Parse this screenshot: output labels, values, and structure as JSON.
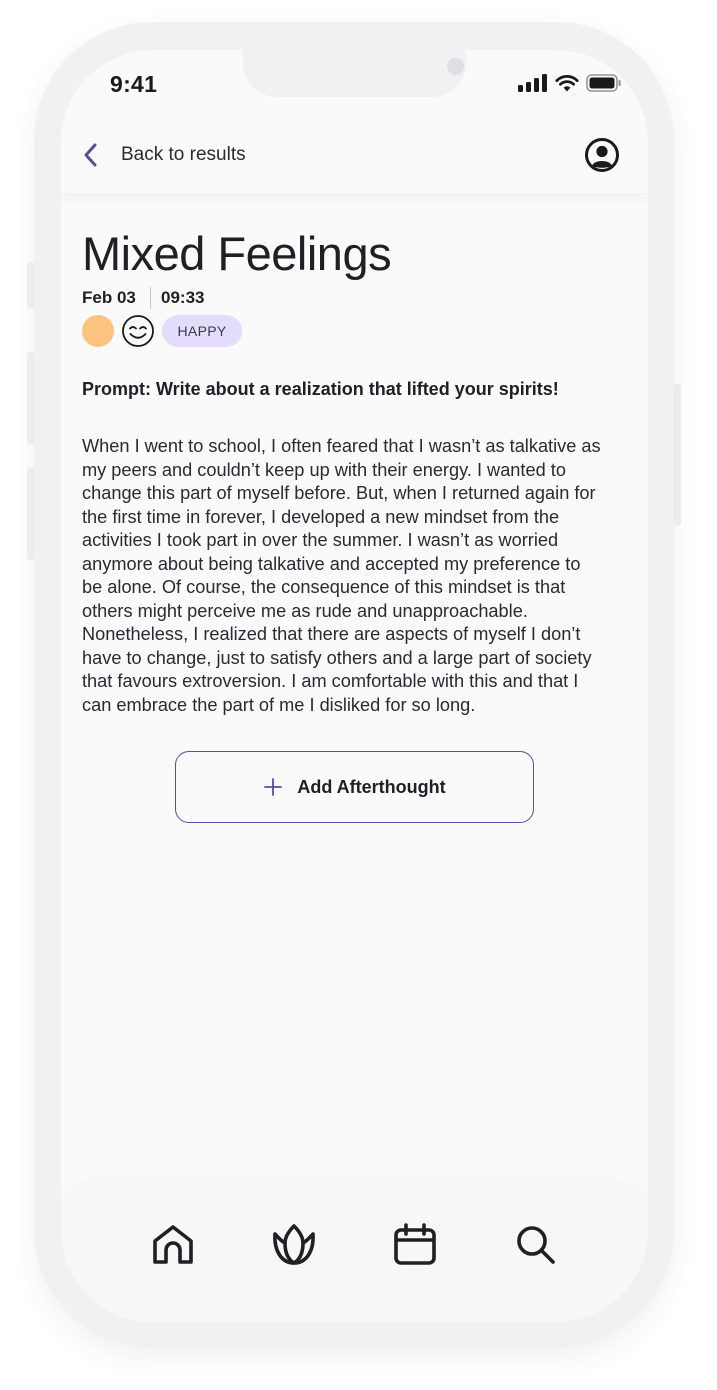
{
  "status_bar": {
    "time": "9:41"
  },
  "header": {
    "back_label": "Back to results"
  },
  "entry": {
    "title": "Mixed Feelings",
    "date": "Feb 03",
    "time": "09:33",
    "mood": {
      "label": "HAPPY",
      "color": "#fdc381",
      "badge_color": "#e4dcfb"
    },
    "prompt": "Prompt: Write about a realization that lifted your spirits!",
    "body_lines": [
      "When I went to school, I often feared that I wasn’t as talkative as",
      "my peers and couldn’t keep up with their energy. I wanted to",
      "change this part of myself before. But, when I returned again for",
      "the first time in forever, I developed a new mindset from the",
      "activities I took part in over the summer. I wasn’t as worried",
      "anymore about being talkative and accepted my preference to",
      "be alone. Of course, the consequence of this mindset is that",
      "others might perceive me as rude and unapproachable.",
      "Nonetheless, I realized that there are aspects of myself I don’t",
      "have to change, just to satisfy others and a large part of society",
      "that favours extroversion. I am comfortable with this and that I",
      "can embrace the part of me I disliked for so long."
    ]
  },
  "actions": {
    "add_afterthought": "Add Afterthought"
  },
  "tabs": [
    {
      "icon": "home-icon"
    },
    {
      "icon": "lotus-icon"
    },
    {
      "icon": "calendar-icon"
    },
    {
      "icon": "search-icon"
    }
  ],
  "colors": {
    "accent": "#5a4d9f",
    "background": "#fafafb"
  }
}
